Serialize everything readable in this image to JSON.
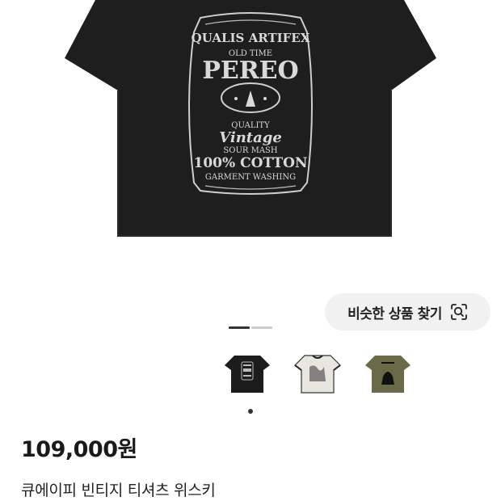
{
  "product_image": {
    "print_lines": [
      "QUALIS ARTIFEX",
      "OLD TIME",
      "PEREO",
      "QUALITY",
      "Vintage",
      "SOUR MASH",
      "100% COTTON",
      "GARMENT WASHING"
    ],
    "shirt_color": "#1e1e1e"
  },
  "similar_button": {
    "label": "비슷한 상품 찾기",
    "icon": "lens-icon"
  },
  "image_pager": {
    "total": 2,
    "active": 1
  },
  "thumbnails": [
    {
      "name": "black-tee",
      "color": "#1c1c1c"
    },
    {
      "name": "white-ringer-tee",
      "color": "#e9e6e0"
    },
    {
      "name": "olive-tee",
      "color": "#6b6a48"
    }
  ],
  "product": {
    "price": "109,000원",
    "title": "큐에이피 빈티지 티셔츠 위스키"
  }
}
